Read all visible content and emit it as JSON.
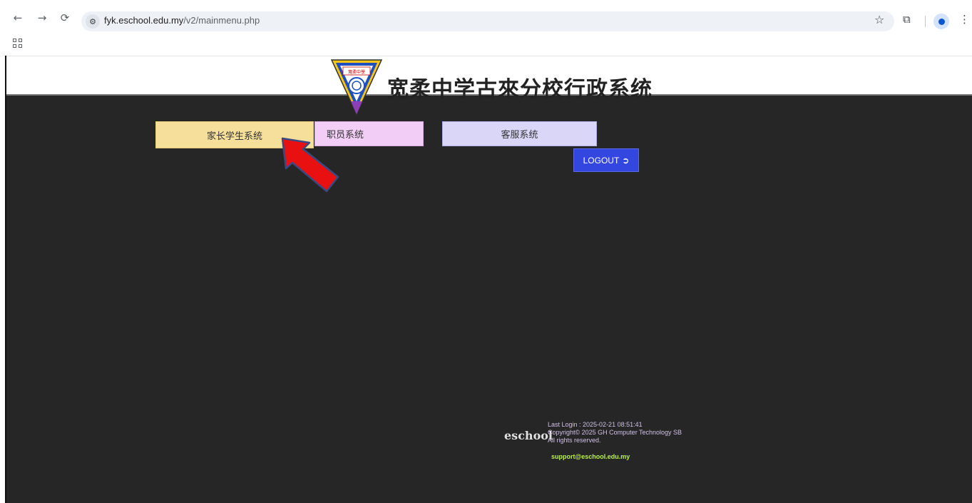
{
  "browser": {
    "url_host": "fyk.eschool.edu.my",
    "url_path": "/v2/mainmenu.php"
  },
  "header": {
    "title": "宽柔中学古來分校行政系统",
    "logo_text": "寬柔中學"
  },
  "menu": {
    "parent_student": "家长学生系统",
    "staff": "职员系统",
    "service": "客服系统",
    "logout": "LOGOUT"
  },
  "footer": {
    "brand": "eschool",
    "last_login": "Last Login : 2025-02-21 08:51:41",
    "copyright": "Copyright© 2025 GH Computer Technology SB",
    "rights": "All rights reserved.",
    "email": "support@eschool.edu.my"
  },
  "colors": {
    "background": "#262626",
    "parent_button": "#f6df9a",
    "staff_button": "#f2cdf6",
    "service_button": "#d9d6f8",
    "logout_button": "#3347e0",
    "annotation_arrow": "#e81010"
  }
}
